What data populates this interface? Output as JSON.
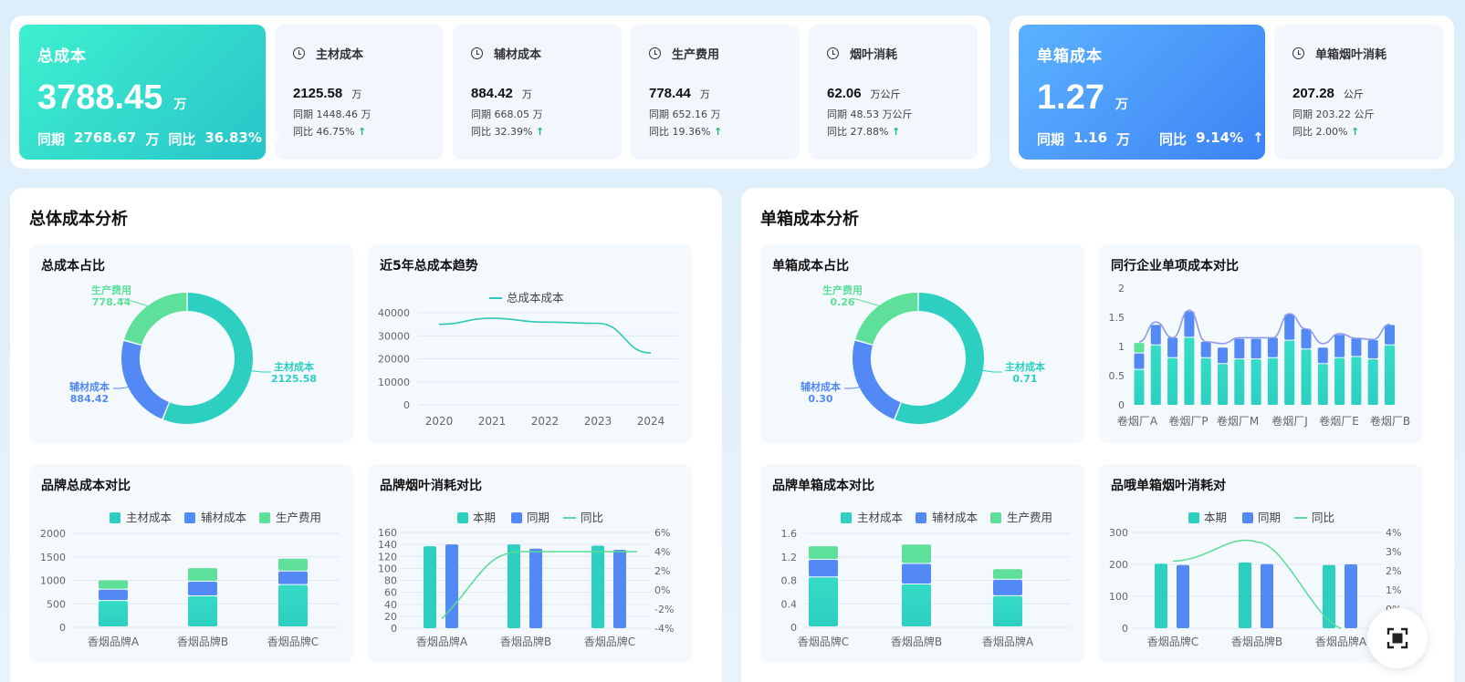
{
  "kpi": {
    "total": {
      "title": "总成本",
      "value": "3788.45",
      "unit": "万",
      "prev_label": "同期",
      "prev_value": "2768.67",
      "prev_unit": "万",
      "yoy_label": "同比",
      "yoy_value": "36.83%"
    },
    "unit_box": {
      "title": "单箱成本",
      "value": "1.27",
      "unit": "万",
      "prev_label": "同期",
      "prev_value": "1.16",
      "prev_unit": "万",
      "yoy_label": "同比",
      "yoy_value": "9.14%"
    },
    "items": [
      {
        "title": "主材成本",
        "value": "2125.58",
        "unit": "万",
        "prev": "同期 1448.46 万",
        "yoy": "同比 46.75%"
      },
      {
        "title": "辅材成本",
        "value": "884.42",
        "unit": "万",
        "prev": "同期 668.05 万",
        "yoy": "同比 32.39%"
      },
      {
        "title": "生产费用",
        "value": "778.44",
        "unit": "万",
        "prev": "同期 652.16 万",
        "yoy": "同比 19.36%"
      },
      {
        "title": "烟叶消耗",
        "value": "62.06",
        "unit": "万公斤",
        "prev": "同期 48.53 万公斤",
        "yoy": "同比 27.88%"
      },
      {
        "title": "单箱烟叶消耗",
        "value": "207.28",
        "unit": "公斤",
        "prev": "同期 203.22 公斤",
        "yoy": "同比 2.00%"
      }
    ],
    "up_arrow": "↑"
  },
  "sections": {
    "left_title": "总体成本分析",
    "right_title": "单箱成本分析"
  },
  "colors": {
    "teal": "#2ccfc0",
    "blue": "#5389f4",
    "green": "#5ee09a",
    "line_teal": "#2cc9b3",
    "line_green": "#59dc98",
    "line_purple": "#8d9be8"
  },
  "chart_data": [
    {
      "id": "total-share",
      "type": "pie",
      "title": "总成本占比",
      "slices": [
        {
          "name": "主材成本",
          "value": 2125.58,
          "label": "2125.58"
        },
        {
          "name": "辅材成本",
          "value": 884.42,
          "label": "884.42"
        },
        {
          "name": "生产费用",
          "value": 778.44,
          "label": "778.44"
        }
      ]
    },
    {
      "id": "total-trend",
      "type": "line",
      "title": "近5年总成本趋势",
      "x": [
        "2020",
        "2021",
        "2022",
        "2023",
        "2024"
      ],
      "series": [
        {
          "name": "总成本成本",
          "values": [
            35000,
            37600,
            35900,
            35400,
            22500
          ]
        }
      ],
      "ylim": [
        0,
        40000
      ],
      "yticks": [
        "40000",
        "30000",
        "20000",
        "10000",
        "0"
      ]
    },
    {
      "id": "unit-share",
      "type": "pie",
      "title": "单箱成本占比",
      "slices": [
        {
          "name": "主材成本",
          "value": 0.71,
          "label": "0.71"
        },
        {
          "name": "辅材成本",
          "value": 0.3,
          "label": "0.30"
        },
        {
          "name": "生产费用",
          "value": 0.26,
          "label": "0.26"
        }
      ]
    },
    {
      "id": "peer-compare",
      "type": "bar",
      "title": "同行企业单项成本对比",
      "categories": [
        "卷烟厂A",
        "卷烟厂P",
        "卷烟厂M",
        "卷烟厂J",
        "卷烟厂E",
        "卷烟厂B"
      ],
      "ylim": [
        0,
        2
      ],
      "yticks": [
        "2",
        "1.5",
        "1",
        "0.5",
        "0"
      ],
      "bars": [
        {
          "teal": 0.6,
          "blue": 0.28,
          "green": 0.18
        },
        {
          "teal": 1.02,
          "blue": 0.35
        },
        {
          "teal": 0.8,
          "blue": 0.35
        },
        {
          "teal": 1.15,
          "blue": 0.45
        },
        {
          "teal": 0.8,
          "blue": 0.28
        },
        {
          "teal": 0.7,
          "blue": 0.28
        },
        {
          "teal": 0.78,
          "blue": 0.35
        },
        {
          "teal": 0.78,
          "blue": 0.35
        },
        {
          "teal": 0.8,
          "blue": 0.35
        },
        {
          "teal": 1.1,
          "blue": 0.45
        },
        {
          "teal": 0.95,
          "blue": 0.35
        },
        {
          "teal": 0.7,
          "blue": 0.28
        },
        {
          "teal": 0.8,
          "blue": 0.4
        },
        {
          "teal": 0.82,
          "blue": 0.32
        },
        {
          "teal": 0.78,
          "blue": 0.33
        },
        {
          "teal": 1.02,
          "blue": 0.35
        }
      ],
      "line": [
        1.08,
        1.42,
        1.15,
        1.62,
        1.08,
        1.05,
        1.15,
        1.15,
        1.15,
        1.56,
        1.3,
        1.05,
        1.22,
        1.14,
        1.12,
        1.38
      ]
    },
    {
      "id": "brand-total",
      "type": "bar",
      "title": "品牌总成本对比",
      "categories": [
        "香烟品牌A",
        "香烟品牌B",
        "香烟品牌C"
      ],
      "series": [
        {
          "name": "主材成本",
          "values": [
            560,
            660,
            900
          ]
        },
        {
          "name": "辅材成本",
          "values": [
            240,
            310,
            290
          ]
        },
        {
          "name": "生产费用",
          "values": [
            200,
            290,
            270
          ]
        }
      ],
      "ylim": [
        0,
        2000
      ],
      "yticks": [
        "2000",
        "1500",
        "1000",
        "500",
        "0"
      ]
    },
    {
      "id": "brand-leaf",
      "type": "bar",
      "title": "品牌烟叶消耗对比",
      "categories": [
        "香烟品牌A",
        "香烟品牌B",
        "香烟品牌C"
      ],
      "series": [
        {
          "name": "本期",
          "values": [
            137,
            140,
            138
          ]
        },
        {
          "name": "同期",
          "values": [
            140,
            133,
            131
          ]
        },
        {
          "name": "同比",
          "values": [
            -3,
            4,
            4
          ]
        }
      ],
      "ylim": [
        0,
        160
      ],
      "yticks": [
        "160",
        "140",
        "120",
        "100",
        "80",
        "60",
        "40",
        "20",
        "0"
      ],
      "y2ticks": [
        "6%",
        "4%",
        "2%",
        "0%",
        "-2%",
        "-4%"
      ]
    },
    {
      "id": "brand-unit",
      "type": "bar",
      "title": "品牌单箱成本对比",
      "categories": [
        "香烟品牌C",
        "香烟品牌B",
        "香烟品牌A"
      ],
      "series": [
        {
          "name": "主材成本",
          "values": [
            0.85,
            0.73,
            0.53
          ]
        },
        {
          "name": "辅材成本",
          "values": [
            0.3,
            0.35,
            0.28
          ]
        },
        {
          "name": "生产费用",
          "values": [
            0.23,
            0.33,
            0.18
          ]
        }
      ],
      "ylim": [
        0,
        1.6
      ],
      "yticks": [
        "1.6",
        "1.2",
        "0.8",
        "0.4",
        "0"
      ]
    },
    {
      "id": "brand-unit-leaf",
      "type": "bar",
      "title": "品哦单箱烟叶消耗对",
      "categories": [
        "香烟品牌C",
        "香烟品牌B",
        "香烟品牌A"
      ],
      "series": [
        {
          "name": "本期",
          "values": [
            202,
            206,
            198
          ]
        },
        {
          "name": "同期",
          "values": [
            198,
            201,
            200
          ]
        },
        {
          "name": "同比",
          "values": [
            2.5,
            3.5,
            -1
          ]
        }
      ],
      "ylim": [
        0,
        300
      ],
      "yticks": [
        "300",
        "200",
        "100",
        "0"
      ],
      "y2ticks": [
        "4%",
        "3%",
        "2%",
        "1%",
        "0%",
        "-1%"
      ]
    }
  ]
}
